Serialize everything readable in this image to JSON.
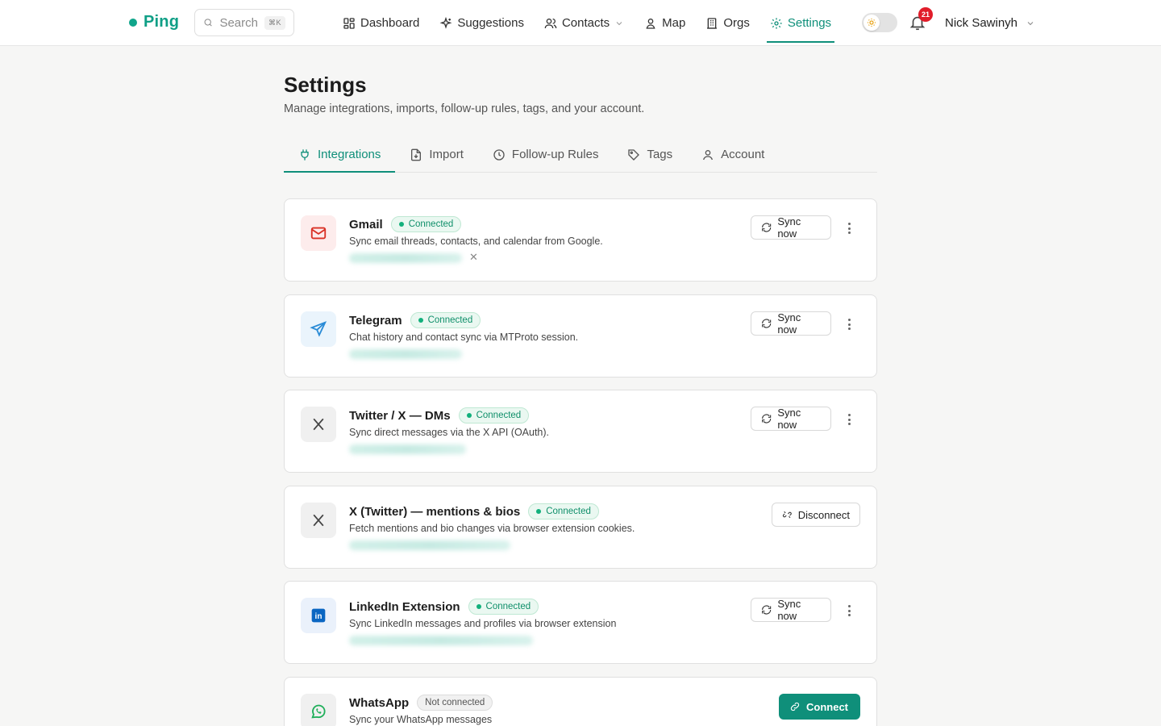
{
  "nav": {
    "logo": "Ping",
    "search_placeholder": "Search",
    "search_shortcut": "⌘K",
    "items": [
      {
        "label": "Dashboard",
        "icon": "dashboard-icon"
      },
      {
        "label": "Suggestions",
        "icon": "sparkles-icon"
      },
      {
        "label": "Contacts",
        "icon": "users-icon"
      },
      {
        "label": "Map",
        "icon": "map-pin-icon"
      },
      {
        "label": "Orgs",
        "icon": "building-icon"
      },
      {
        "label": "Settings",
        "icon": "gear-icon",
        "active": true
      }
    ],
    "notifications_count": "21",
    "user_name": "Nick Sawinyh"
  },
  "header": {
    "title": "Settings",
    "subtitle": "Manage integrations, imports, follow-up rules, tags, and your account."
  },
  "tabs": [
    {
      "label": "Integrations",
      "icon": "plug-icon",
      "active": true
    },
    {
      "label": "Import",
      "icon": "file-import-icon"
    },
    {
      "label": "Follow-up Rules",
      "icon": "clock-icon"
    },
    {
      "label": "Tags",
      "icon": "tag-icon"
    },
    {
      "label": "Account",
      "icon": "user-icon"
    }
  ],
  "integrations": [
    {
      "name": "Gmail",
      "status": "Connected",
      "description": "Sync email threads, contacts, and calendar from Google.",
      "action": "Sync now",
      "icon": "mail-icon"
    },
    {
      "name": "Telegram",
      "status": "Connected",
      "description": "Chat history and contact sync via MTProto session.",
      "action": "Sync now",
      "icon": "send-icon"
    },
    {
      "name": "Twitter / X — DMs",
      "status": "Connected",
      "description": "Sync direct messages via the X API (OAuth).",
      "action": "Sync now",
      "icon": "x-logo-icon"
    },
    {
      "name": "X (Twitter) — mentions & bios",
      "status": "Connected",
      "description": "Fetch mentions and bio changes via browser extension cookies.",
      "action": "Disconnect",
      "icon": "x-logo-icon"
    },
    {
      "name": "LinkedIn Extension",
      "status": "Connected",
      "description": "Sync LinkedIn messages and profiles via browser extension",
      "action": "Sync now",
      "icon": "linkedin-icon"
    },
    {
      "name": "WhatsApp",
      "status": "Not connected",
      "description": "Sync your WhatsApp messages",
      "action": "Connect",
      "icon": "whatsapp-icon"
    }
  ],
  "colors": {
    "accent": "#0f8f7a",
    "connected": "#12b07c",
    "gmail_red": "#d93025",
    "telegram_blue": "#2a8bd6",
    "linkedin_blue": "#0a66c2",
    "whatsapp_green": "#1faf5a"
  }
}
